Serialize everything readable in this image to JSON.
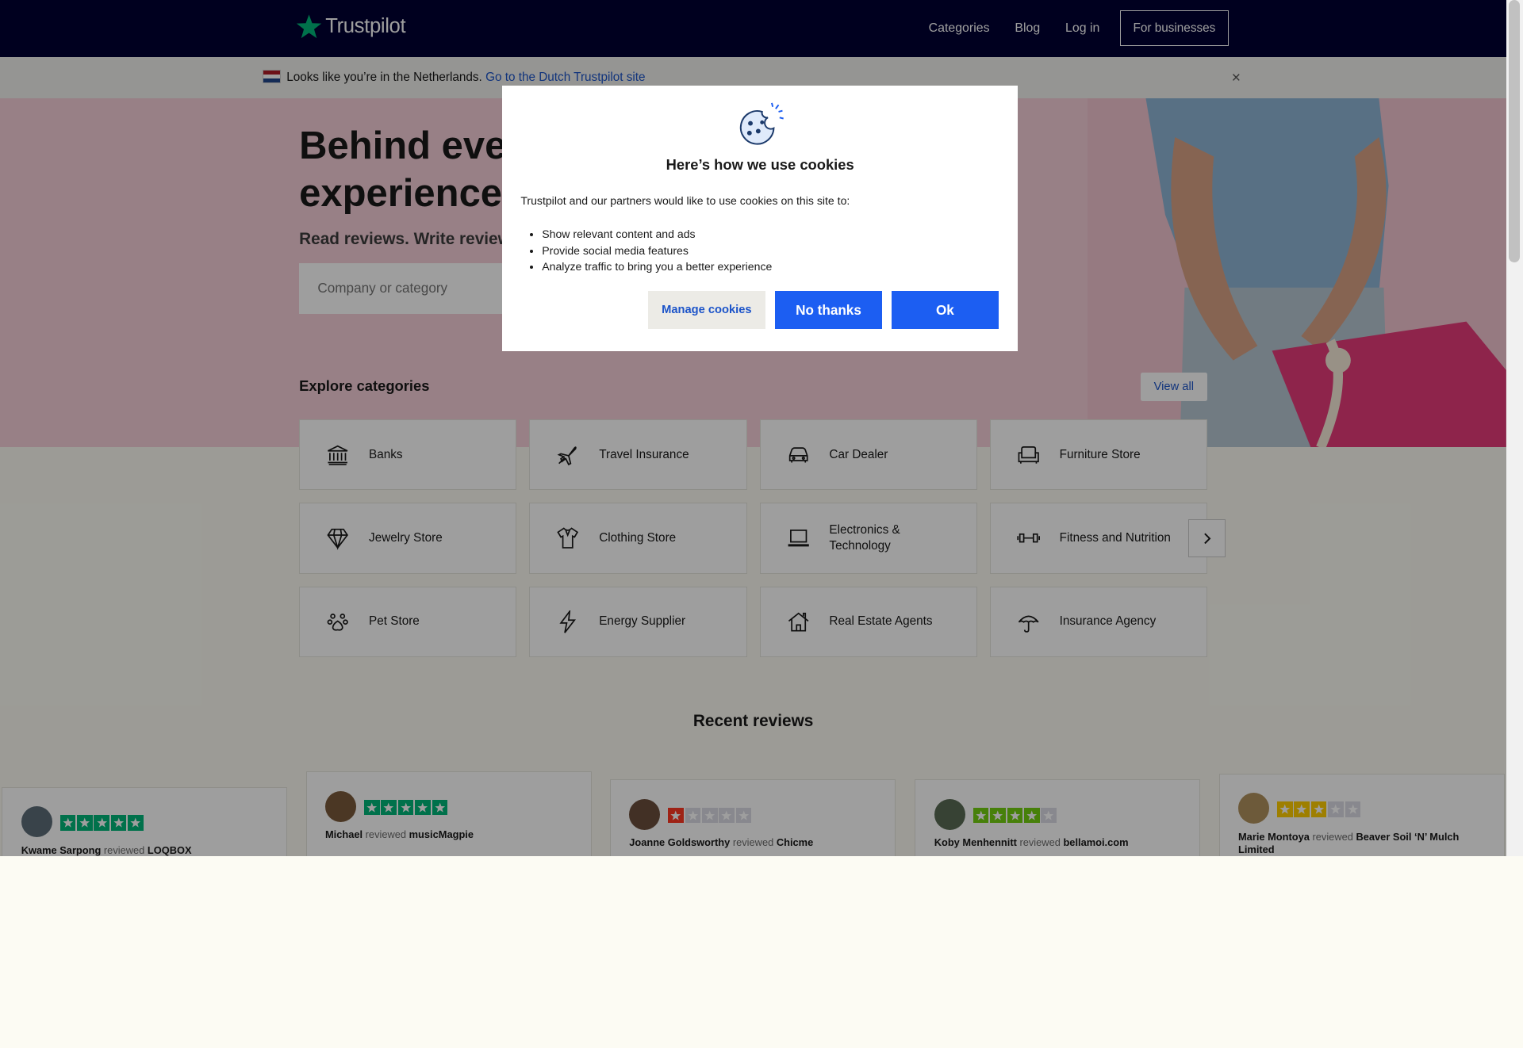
{
  "header": {
    "brand": "Trustpilot",
    "nav": [
      "Categories",
      "Blog",
      "Log in"
    ],
    "business_button": "For businesses"
  },
  "locale_banner": {
    "text": "Looks like you’re in the Netherlands.",
    "link": "Go to the Dutch Trustpilot site",
    "close": "×"
  },
  "hero": {
    "title_line1": "Behind ever",
    "title_line2": "experience",
    "subtitle": "Read reviews. Write review",
    "search_placeholder": "Company or category"
  },
  "categories": {
    "heading": "Explore categories",
    "view_all": "View all",
    "items": [
      {
        "label": "Banks",
        "icon": "bank-icon"
      },
      {
        "label": "Travel Insurance",
        "icon": "airplane-icon"
      },
      {
        "label": "Car Dealer",
        "icon": "car-icon"
      },
      {
        "label": "Furniture Store",
        "icon": "sofa-icon"
      },
      {
        "label": "Jewelry Store",
        "icon": "diamond-icon"
      },
      {
        "label": "Clothing Store",
        "icon": "shirt-icon"
      },
      {
        "label": "Electronics & Technology",
        "icon": "laptop-icon"
      },
      {
        "label": "Fitness and Nutrition",
        "icon": "dumbbell-icon"
      },
      {
        "label": "Pet Store",
        "icon": "paw-icon"
      },
      {
        "label": "Energy Supplier",
        "icon": "lightning-icon"
      },
      {
        "label": "Real Estate Agents",
        "icon": "house-icon"
      },
      {
        "label": "Insurance Agency",
        "icon": "umbrella-icon"
      }
    ]
  },
  "recent_reviews": {
    "heading": "Recent reviews",
    "reviewed_word": "reviewed",
    "items": [
      {
        "name": "Kwame Sarpong",
        "company": "LOQBOX",
        "rating": 5
      },
      {
        "name": "Michael",
        "company": "musicMagpie",
        "rating": 5
      },
      {
        "name": "Joanne Goldsworthy",
        "company": "Chicme",
        "rating": 1
      },
      {
        "name": "Koby Menhennitt",
        "company": "bellamoi.com",
        "rating": 4
      },
      {
        "name": "Marie Montoya",
        "company": "Beaver Soil ‘N’ Mulch Limited",
        "rating": 3
      }
    ]
  },
  "cookie_modal": {
    "title": "Here’s how we use cookies",
    "intro": "Trustpilot and our partners would like to use cookies on this site to:",
    "bullets": [
      "Show relevant content and ads",
      "Provide social media features",
      "Analyze traffic to bring you a better experience"
    ],
    "manage_button": "Manage cookies",
    "no_button": "No thanks",
    "ok_button": "Ok"
  },
  "colors": {
    "header_bg": "#000032",
    "brand_green": "#00b67a",
    "hero_bg": "#f6cfd9",
    "link_blue": "#1c54c9",
    "primary_button": "#1c5ef2",
    "star_red": "#ff3722",
    "star_yellow": "#ffce00",
    "star_lightgreen": "#73cf11"
  }
}
